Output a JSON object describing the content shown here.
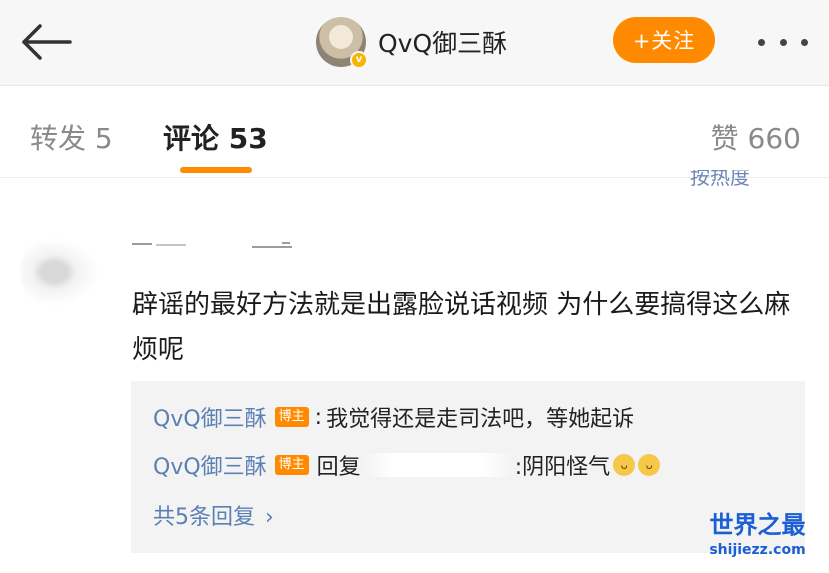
{
  "header": {
    "username": "QvQ御三酥",
    "follow_label": "+关注",
    "verified_badge": "v"
  },
  "tabs": {
    "repost": "转发 5",
    "comment": "评论 53",
    "like": "赞 660"
  },
  "sort_label": "按热度",
  "comment": {
    "text": "辟谣的最好方法就是出露脸说话视频 为什么要搞得这么麻烦呢"
  },
  "replies": [
    {
      "author": "QvQ御三酥",
      "tag": "博主",
      "text": "我觉得还是走司法吧，等她起诉"
    },
    {
      "author": "QvQ御三酥",
      "tag": "博主",
      "prefix": "回复",
      "suffix": ":阴阳怪气",
      "emojis": [
        "cat-face-icon",
        "cat-face-icon"
      ]
    }
  ],
  "reply_total": "共5条回复",
  "watermark": {
    "main": "世界之最",
    "sub": "shijiezz.com"
  },
  "colors": {
    "accent": "#ff8a00",
    "link": "#5b80b6",
    "reply_bg": "#f3f3f3"
  }
}
